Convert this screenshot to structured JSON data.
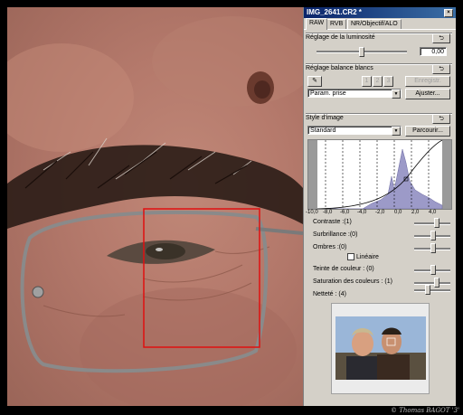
{
  "window_title": "IMG_2641.CR2 *",
  "tabs": [
    {
      "label": "RAW",
      "active": true
    },
    {
      "label": "RVB",
      "active": false
    },
    {
      "label": "NR/Objectif/ALO",
      "active": false
    }
  ],
  "brightness": {
    "title": "Réglage de la luminosité",
    "value": "0,00",
    "slider_fraction": 0.5
  },
  "white_balance": {
    "title": "Réglage balance blancs",
    "register_label": "Enregistr.",
    "preset_buttons": [
      "1",
      "2",
      "3"
    ],
    "mode": "Param. prise",
    "adjust_label": "Ajuster..."
  },
  "picture_style": {
    "title": "Style d'image",
    "value": "Standard",
    "browse_label": "Parcourir..."
  },
  "histogram": {
    "axis_ticks": [
      "-10,0",
      "-8,0",
      "-6,0",
      "-4,0",
      "-2,0",
      "0,0",
      "2,0",
      "4,0"
    ]
  },
  "adjustments": [
    {
      "label": "Contraste :(1)",
      "fraction": 0.62
    },
    {
      "label": "Surbrillance :(0)",
      "fraction": 0.5
    },
    {
      "label": "Ombres :(0)",
      "fraction": 0.5
    },
    {
      "label": "Teinte de couleur : (0)",
      "fraction": 0.5
    },
    {
      "label": "Saturation des couleurs : (1)",
      "fraction": 0.62
    },
    {
      "label": "Netteté : (4)",
      "fraction": 0.35
    }
  ],
  "linear_checkbox": {
    "label": "Linéaire",
    "checked": false
  },
  "signature": "© Thomas BAGOT '3'",
  "colors": {
    "crop_frame": "#e01010",
    "titlebar": "#0a246a"
  }
}
